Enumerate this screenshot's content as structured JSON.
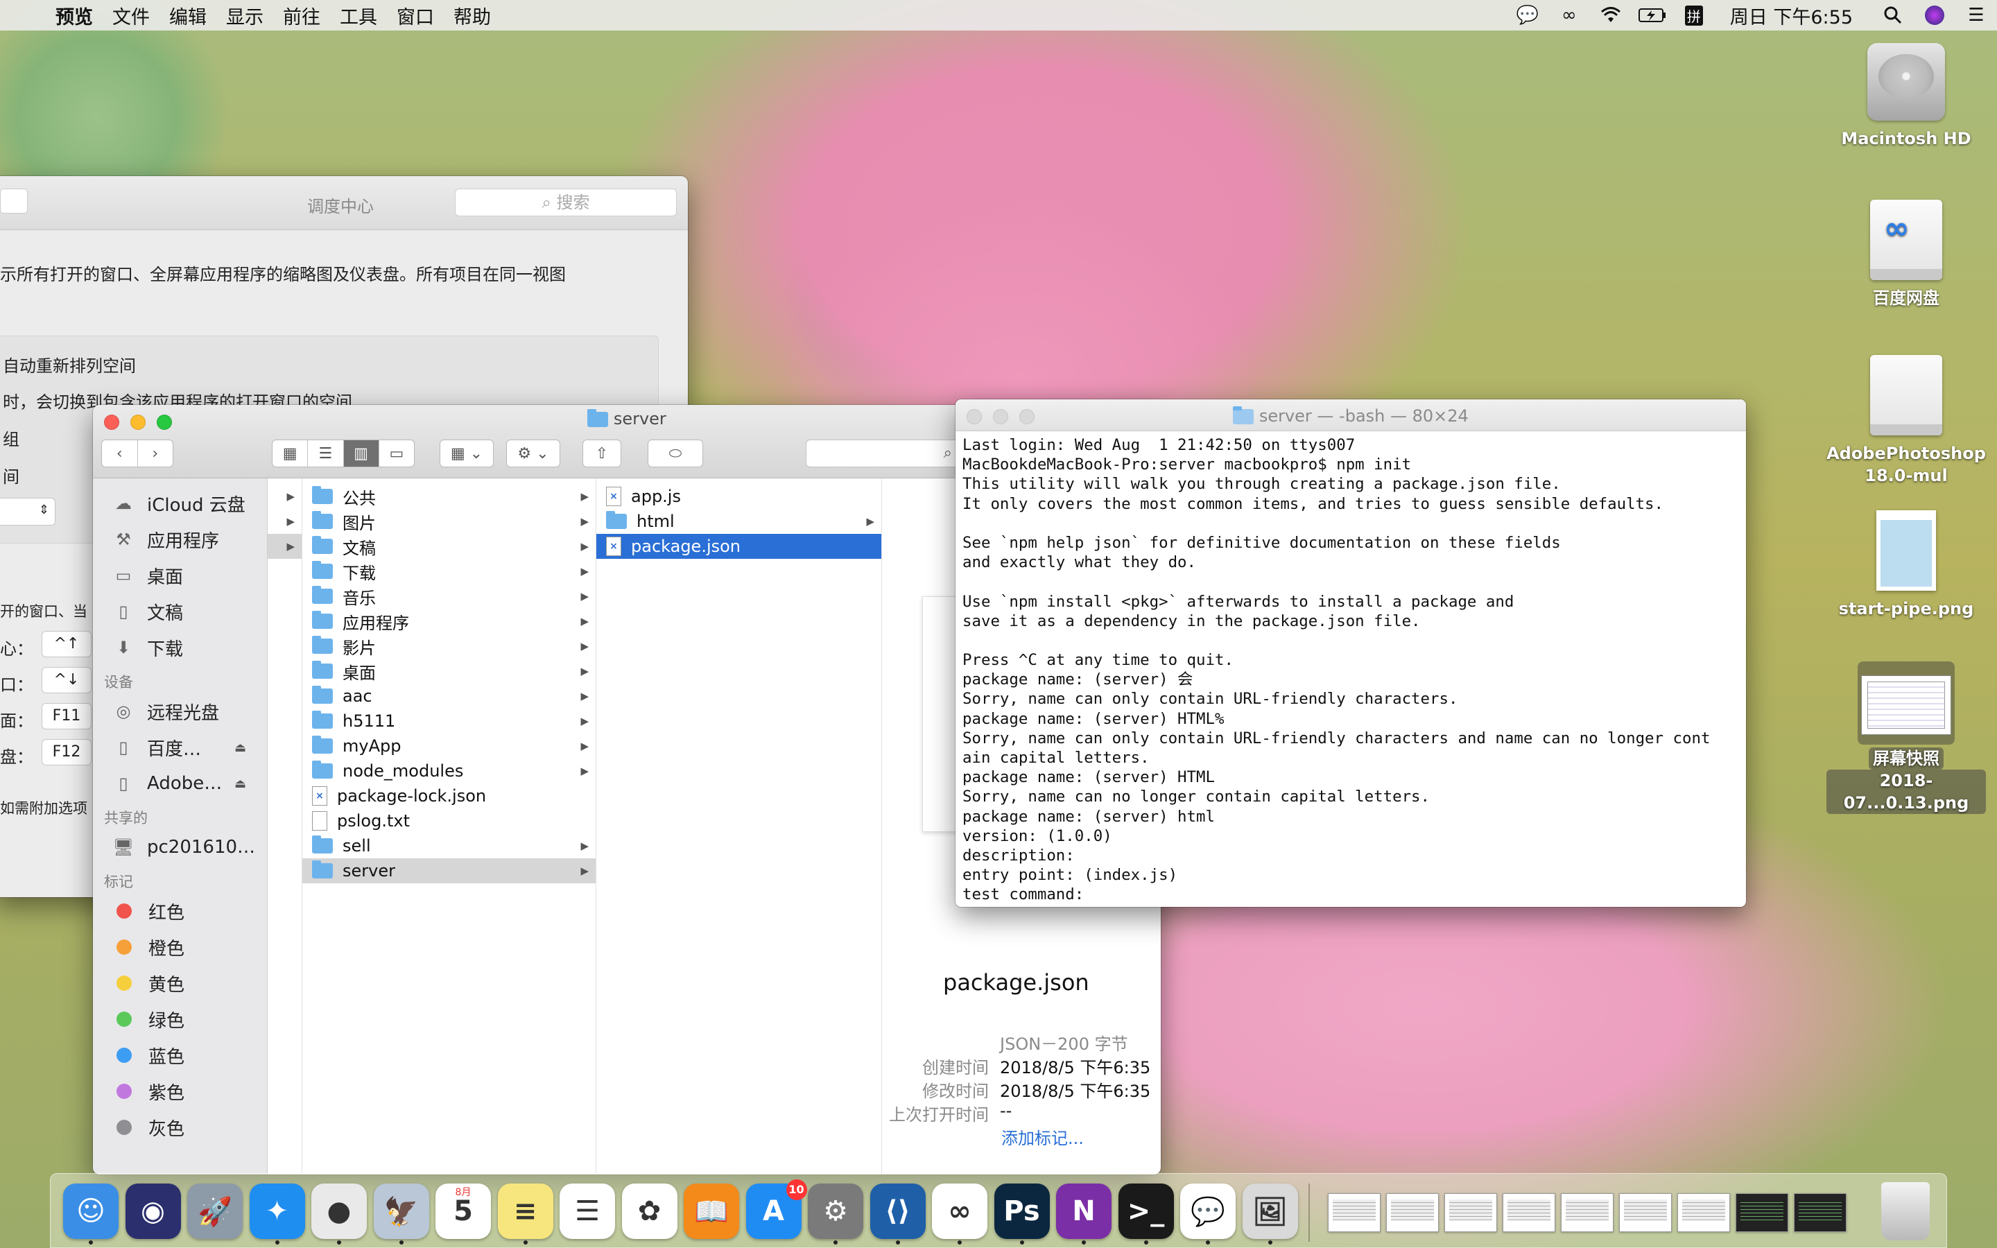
{
  "menubar": {
    "items": [
      "预览",
      "文件",
      "编辑",
      "显示",
      "前往",
      "工具",
      "窗口",
      "帮助"
    ],
    "clock": "周日 下午6:55",
    "status_icons": [
      "wechat-icon",
      "creative-cloud-icon",
      "wifi-icon",
      "battery-icon",
      "input-method-icon"
    ],
    "input_method": "拼"
  },
  "desktop": {
    "icons": [
      {
        "label": "Macintosh HD"
      },
      {
        "label": "百度网盘"
      },
      {
        "label": "AdobePhotoshop18.0-mul"
      },
      {
        "label": "start-pipe.png"
      },
      {
        "label_line1": "屏幕快照",
        "label_line2": "2018-07...0.13.png"
      }
    ]
  },
  "prefs": {
    "title": "调度中心",
    "search_placeholder": "搜索",
    "description": "示所有打开的窗口、全屏幕应用程序的缩略图及仪表盘。所有项目在同一视图",
    "option1": "自动重新排列空间",
    "option2": "时，会切换到包含该应用程序的打开窗口的空间",
    "option3": "组",
    "option4": "间",
    "option5": "开的窗口、当",
    "shortcut_labels": [
      "心：",
      "口：",
      "面：",
      "盘："
    ],
    "shortcut_keys": [
      "^↑",
      "^↓",
      "F11",
      "F12"
    ],
    "footer": "如需附加选项"
  },
  "finder": {
    "title": "server",
    "sidebar": {
      "favorites": [
        {
          "label": "iCloud 云盘",
          "icon": "cloud-icon"
        },
        {
          "label": "应用程序",
          "icon": "applications-icon"
        },
        {
          "label": "桌面",
          "icon": "desktop-icon"
        },
        {
          "label": "文稿",
          "icon": "documents-icon"
        },
        {
          "label": "下载",
          "icon": "downloads-icon"
        }
      ],
      "devices_header": "设备",
      "devices": [
        {
          "label": "远程光盘",
          "icon": "disc-icon"
        },
        {
          "label": "百度…",
          "icon": "drive-icon"
        },
        {
          "label": "Adobe…",
          "icon": "drive-icon"
        }
      ],
      "shared_header": "共享的",
      "shared": [
        {
          "label": "pc201610…",
          "icon": "computer-icon"
        }
      ],
      "tags_header": "标记",
      "tags": [
        {
          "label": "红色",
          "color": "#f0544c"
        },
        {
          "label": "橙色",
          "color": "#f6a03a"
        },
        {
          "label": "黄色",
          "color": "#f5cf3c"
        },
        {
          "label": "绿色",
          "color": "#5bc95a"
        },
        {
          "label": "蓝色",
          "color": "#3d9df2"
        },
        {
          "label": "紫色",
          "color": "#c178de"
        },
        {
          "label": "灰色",
          "color": "#8e8e93"
        }
      ]
    },
    "column1": [
      {
        "name": "公共"
      },
      {
        "name": "图片"
      },
      {
        "name": "文稿"
      },
      {
        "name": "下载"
      },
      {
        "name": "音乐"
      },
      {
        "name": "应用程序"
      },
      {
        "name": "影片"
      },
      {
        "name": "桌面"
      },
      {
        "name": "aac"
      },
      {
        "name": "h5111"
      },
      {
        "name": "myApp"
      },
      {
        "name": "node_modules"
      },
      {
        "name": "package-lock.json"
      },
      {
        "name": "pslog.txt"
      },
      {
        "name": "sell"
      },
      {
        "name": "server"
      }
    ],
    "column2": [
      {
        "name": "app.js"
      },
      {
        "name": "html"
      },
      {
        "name": "package.json"
      }
    ],
    "preview": {
      "name": "package.json",
      "kind": "JSON－200 字节",
      "created_label": "创建时间",
      "created": "2018/8/5 下午6:35",
      "modified_label": "修改时间",
      "modified": "2018/8/5 下午6:35",
      "opened_label": "上次打开时间",
      "opened": "--",
      "add_tags": "添加标记..."
    }
  },
  "terminal": {
    "title": "server — -bash — 80×24",
    "lines": [
      "Last login: Wed Aug  1 21:42:50 on ttys007",
      "MacBookdeMacBook-Pro:server macbookpro$ npm init",
      "This utility will walk you through creating a package.json file.",
      "It only covers the most common items, and tries to guess sensible defaults.",
      "",
      "See `npm help json` for definitive documentation on these fields",
      "and exactly what they do.",
      "",
      "Use `npm install <pkg>` afterwards to install a package and",
      "save it as a dependency in the package.json file.",
      "",
      "Press ^C at any time to quit.",
      "package name: (server) 会",
      "Sorry, name can only contain URL-friendly characters.",
      "package name: (server) HTML%",
      "Sorry, name can only contain URL-friendly characters and name can no longer cont",
      "ain capital letters.",
      "package name: (server) HTML",
      "Sorry, name can no longer contain capital letters.",
      "package name: (server) html",
      "version: (1.0.0)",
      "description:",
      "entry point: (index.js)",
      "test command:"
    ]
  },
  "dock": {
    "apps": [
      {
        "name": "finder-icon",
        "color": "#3a8ee6",
        "glyph": "☺"
      },
      {
        "name": "siri-icon",
        "color": "#2b2f6e",
        "glyph": "◉"
      },
      {
        "name": "launchpad-icon",
        "color": "#8d9aa8",
        "glyph": "🚀"
      },
      {
        "name": "safari-icon",
        "color": "#1e8ef0",
        "glyph": "✦"
      },
      {
        "name": "chrome-icon",
        "color": "#e9e9e9",
        "glyph": "●"
      },
      {
        "name": "preview-icon",
        "color": "#b9c7d6",
        "glyph": "🦅"
      },
      {
        "name": "calendar-icon",
        "color": "#ffffff",
        "glyph": "5"
      },
      {
        "name": "notes-icon",
        "color": "#f7e67d",
        "glyph": "≡"
      },
      {
        "name": "reminders-icon",
        "color": "#ffffff",
        "glyph": "☰"
      },
      {
        "name": "photos-icon",
        "color": "#ffffff",
        "glyph": "✿"
      },
      {
        "name": "books-icon",
        "color": "#f38a1a",
        "glyph": "📖"
      },
      {
        "name": "app-store-icon",
        "color": "#1f8cf4",
        "glyph": "A"
      },
      {
        "name": "system-preferences-icon",
        "color": "#7a7a7a",
        "glyph": "⚙"
      },
      {
        "name": "vscode-icon",
        "color": "#1e5fa8",
        "glyph": "⟨⟩"
      },
      {
        "name": "baidu-netdisk-icon",
        "color": "#ffffff",
        "glyph": "∞"
      },
      {
        "name": "photoshop-icon",
        "color": "#0b2740",
        "glyph": "Ps"
      },
      {
        "name": "onenote-icon",
        "color": "#7b2fa6",
        "glyph": "N"
      },
      {
        "name": "terminal-icon",
        "color": "#1a1a1a",
        "glyph": ">_"
      },
      {
        "name": "wechat-icon",
        "color": "#ffffff",
        "glyph": "💬"
      },
      {
        "name": "preview-screenshot-icon",
        "color": "#d9d9d9",
        "glyph": "🖼"
      }
    ],
    "app_store_badge": "10",
    "calendar_month": "8月"
  }
}
